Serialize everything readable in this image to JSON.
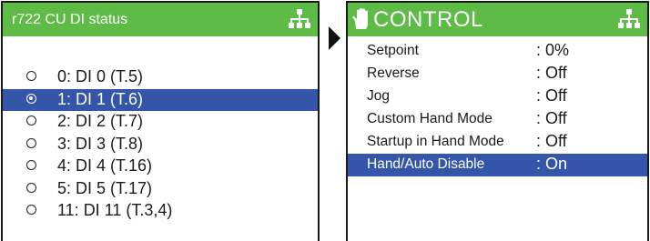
{
  "left_panel": {
    "title": "r722 CU DI status",
    "items": [
      {
        "label": "0: DI 0 (T.5)",
        "selected": false
      },
      {
        "label": "1: DI 1 (T.6)",
        "selected": true
      },
      {
        "label": "2: DI 2 (T.7)",
        "selected": false
      },
      {
        "label": "3: DI 3 (T.8)",
        "selected": false
      },
      {
        "label": "4: DI 4 (T.16)",
        "selected": false
      },
      {
        "label": "5: DI 5 (T.17)",
        "selected": false
      },
      {
        "label": "11: DI 11 (T.3,4)",
        "selected": false
      }
    ]
  },
  "right_panel": {
    "title": "CONTROL",
    "rows": [
      {
        "name": "Setpoint",
        "value": ": 0%",
        "selected": false
      },
      {
        "name": "Reverse",
        "value": ": Off",
        "selected": false
      },
      {
        "name": "Jog",
        "value": ": Off",
        "selected": false
      },
      {
        "name": "Custom Hand Mode",
        "value": ": Off",
        "selected": false
      },
      {
        "name": "Startup in Hand Mode",
        "value": ": Off",
        "selected": false
      },
      {
        "name": "Hand/Auto Disable",
        "value": ": On",
        "selected": true
      }
    ]
  },
  "colors": {
    "header_green": "#5dbb46",
    "selection_blue": "#3556a8"
  },
  "icons": [
    "network-icon",
    "hand-icon",
    "arrow-right-icon",
    "radio-icon"
  ]
}
